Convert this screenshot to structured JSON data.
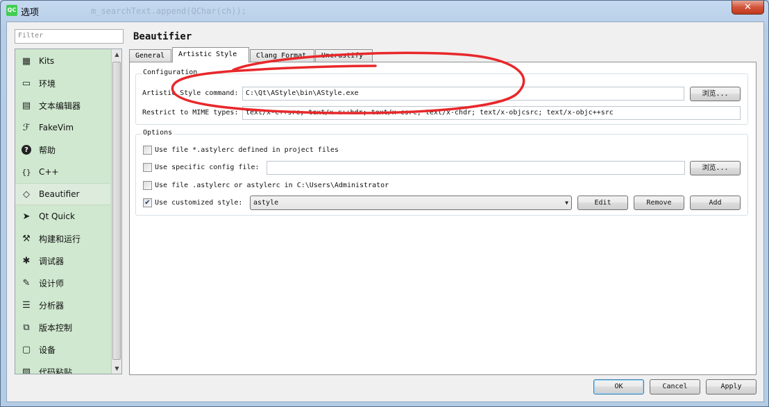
{
  "window": {
    "title": "选项",
    "app_icon_text": "QC",
    "background_text": "m_searchText.append(QChar(ch));",
    "close_symbol": "✕"
  },
  "filter": {
    "placeholder": "Filter"
  },
  "categories": [
    {
      "label": "Kits",
      "icon": "kits-icon"
    },
    {
      "label": "环境",
      "icon": "monitor-icon"
    },
    {
      "label": "文本编辑器",
      "icon": "text-editor-icon"
    },
    {
      "label": "FakeVim",
      "icon": "fakevim-icon"
    },
    {
      "label": "帮助",
      "icon": "help-icon"
    },
    {
      "label": "C++",
      "icon": "braces-icon"
    },
    {
      "label": "Beautifier",
      "icon": "diamond-icon",
      "selected": true
    },
    {
      "label": "Qt Quick",
      "icon": "qtquick-icon"
    },
    {
      "label": "构建和运行",
      "icon": "hammer-icon"
    },
    {
      "label": "调试器",
      "icon": "bug-icon"
    },
    {
      "label": "设计师",
      "icon": "pencil-icon"
    },
    {
      "label": "分析器",
      "icon": "analyzer-icon"
    },
    {
      "label": "版本控制",
      "icon": "version-control-icon"
    },
    {
      "label": "设备",
      "icon": "device-icon"
    },
    {
      "label": "代码粘贴",
      "icon": "clipboard-icon"
    }
  ],
  "page": {
    "title": "Beautifier",
    "tabs": [
      {
        "label": "General"
      },
      {
        "label": "Artistic Style",
        "active": true
      },
      {
        "label": "Clang Format"
      },
      {
        "label": "Uncrustify"
      }
    ]
  },
  "configuration": {
    "title": "Configuration",
    "command_label": "Artistic Style command:",
    "command_value": "C:\\Qt\\AStyle\\bin\\AStyle.exe",
    "browse_label": "浏览...",
    "mime_label": "Restrict to MIME types:",
    "mime_value": "text/x-c++src; text/x-c++hdr; text/x-csrc; text/x-chdr; text/x-objcsrc; text/x-objc++src"
  },
  "options": {
    "title": "Options",
    "use_astylerc_label": "Use file *.astylerc defined in project files",
    "use_astylerc_checked": false,
    "use_config_label": "Use specific config file:",
    "use_config_checked": false,
    "config_value": "",
    "browse_label": "浏览...",
    "use_home_label": "Use file .astylerc or astylerc in C:\\Users\\Administrator",
    "use_home_checked": false,
    "use_custom_label": "Use customized style:",
    "use_custom_checked": true,
    "custom_style_value": "astyle",
    "edit_label": "Edit",
    "remove_label": "Remove",
    "add_label": "Add"
  },
  "dialog_buttons": {
    "ok": "OK",
    "cancel": "Cancel",
    "apply": "Apply"
  },
  "colors": {
    "annotation": "#e8282b",
    "sidebar_bg": "#cfe8cf"
  }
}
